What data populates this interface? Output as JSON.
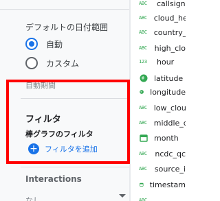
{
  "date_range": {
    "title": "デフォルトの日付範囲",
    "options": [
      {
        "label": "自動",
        "selected": true
      },
      {
        "label": "カスタム",
        "selected": false
      }
    ],
    "auto_period_label": "自動期間"
  },
  "filter": {
    "heading": "フィルタ",
    "sub_heading": "棒グラフのフィルタ",
    "add_filter_label": "フィルタを追加"
  },
  "interactions": {
    "heading": "Interactions",
    "select_value": "なし"
  },
  "fields": [
    {
      "type": "ABC",
      "name": "callsign"
    },
    {
      "type": "ABC",
      "name": "cloud_he"
    },
    {
      "type": "ABC",
      "name": "country_"
    },
    {
      "type": "ABC",
      "name": "high_clo"
    },
    {
      "type": "123",
      "name": "hour"
    },
    {
      "type": "geo",
      "name": "latitude"
    },
    {
      "type": "geo",
      "name": "longitude"
    },
    {
      "type": "ABC",
      "name": "low_clou"
    },
    {
      "type": "ABC",
      "name": "middle_c"
    },
    {
      "type": "date",
      "name": "month"
    },
    {
      "type": "ABC",
      "name": "ncdc_qc"
    },
    {
      "type": "ABC",
      "name": "source_i"
    },
    {
      "type": "date",
      "name": "timestam"
    },
    {
      "type": "ABC",
      "name": ""
    }
  ],
  "colors": {
    "accent": "#1a73e8",
    "field_type": "#34a853",
    "highlight_box": "#ff0000"
  }
}
